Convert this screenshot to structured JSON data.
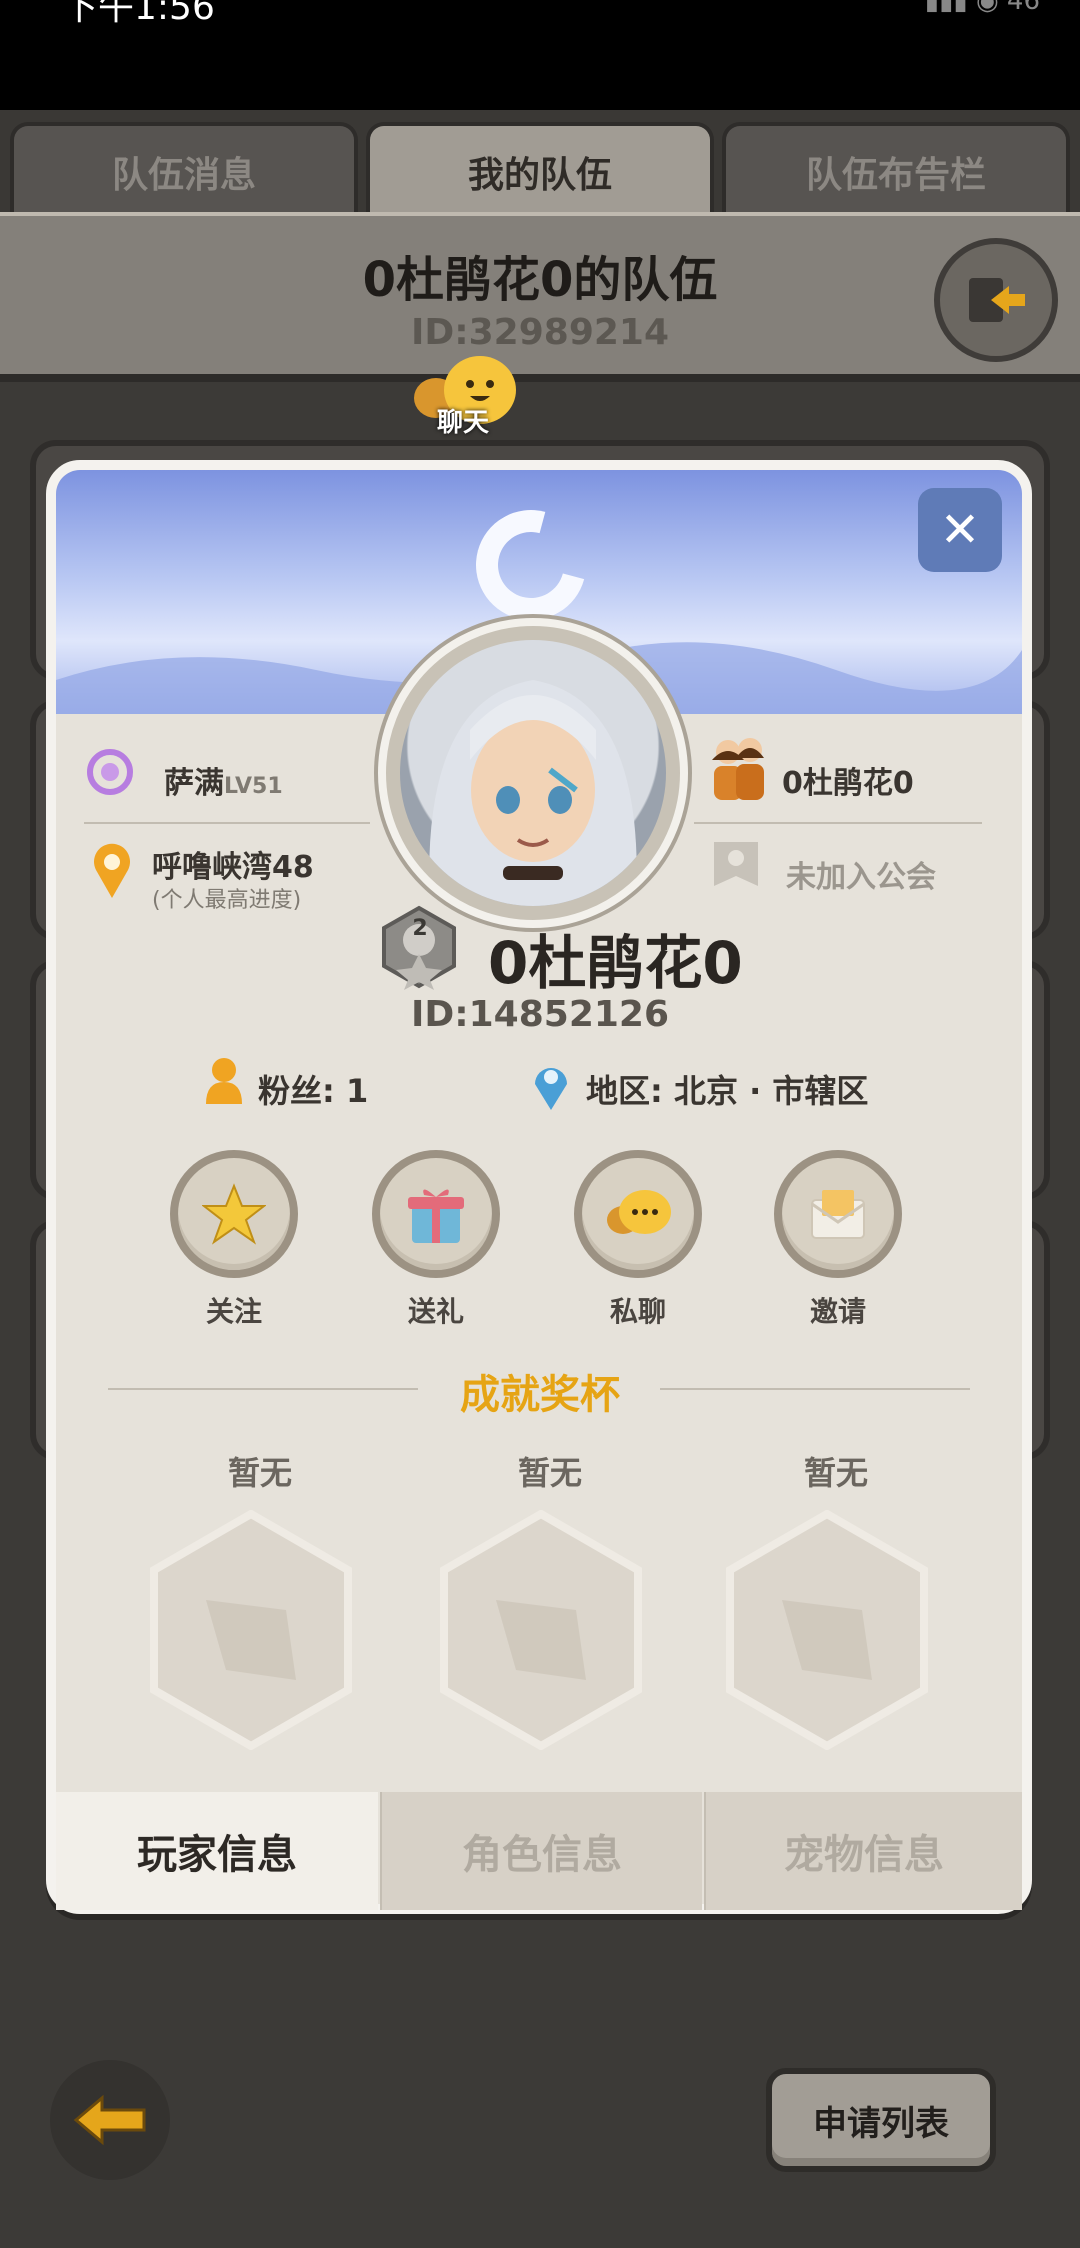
{
  "status_bar": {
    "time": "下午1:56",
    "icons": "▮▮▮ ◉ 46"
  },
  "tabs": [
    {
      "label": "队伍消息"
    },
    {
      "label": "我的队伍"
    },
    {
      "label": "队伍布告栏"
    }
  ],
  "team": {
    "name": "0杜鹃花0的队伍",
    "id": "ID:32989214"
  },
  "chat": {
    "label": "聊天"
  },
  "profile": {
    "job": "萨满",
    "level": "LV51",
    "progress_name": "呼噜峡湾48",
    "progress_sub": "(个人最高进度)",
    "team_member": "0杜鹃花0",
    "guild": "未加入公会",
    "rank_badge": "2",
    "name": "0杜鹃花0",
    "id": "ID:14852126",
    "fans": "粉丝: 1",
    "region": "地区: 北京 · 市辖区"
  },
  "actions": [
    {
      "label": "关注",
      "icon": "star-icon"
    },
    {
      "label": "送礼",
      "icon": "gift-icon"
    },
    {
      "label": "私聊",
      "icon": "chat-icon"
    },
    {
      "label": "邀请",
      "icon": "envelope-icon"
    }
  ],
  "trophies": {
    "title": "成就奖杯",
    "items": [
      {
        "label": "暂无"
      },
      {
        "label": "暂无"
      },
      {
        "label": "暂无"
      }
    ]
  },
  "card_tabs": [
    {
      "label": "玩家信息"
    },
    {
      "label": "角色信息"
    },
    {
      "label": "宠物信息"
    }
  ],
  "bottom": {
    "apply_label": "申请列表"
  },
  "colors": {
    "accent_gold": "#e6a414",
    "banner_blue": "#7d93e0",
    "close_blue": "#5f7bb7"
  }
}
